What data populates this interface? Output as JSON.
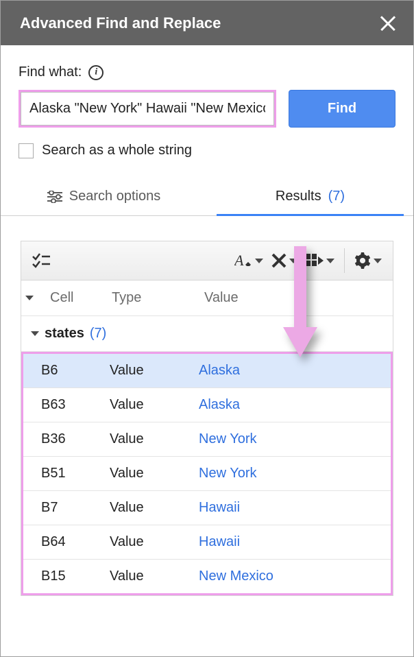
{
  "header": {
    "title": "Advanced Find and Replace"
  },
  "find": {
    "label": "Find what:",
    "value": "Alaska \"New York\" Hawaii \"New Mexico\"",
    "button": "Find",
    "whole_string_label": "Search as a whole string"
  },
  "tabs": {
    "search_options": "Search options",
    "results_label": "Results",
    "results_count": "(7)"
  },
  "table": {
    "headers": {
      "cell": "Cell",
      "type": "Type",
      "value": "Value"
    },
    "group": {
      "name": "states",
      "count": "(7)"
    },
    "rows": [
      {
        "cell": "B6",
        "type": "Value",
        "value": "Alaska",
        "selected": true
      },
      {
        "cell": "B63",
        "type": "Value",
        "value": "Alaska",
        "selected": false
      },
      {
        "cell": "B36",
        "type": "Value",
        "value": "New York",
        "selected": false
      },
      {
        "cell": "B51",
        "type": "Value",
        "value": "New York",
        "selected": false
      },
      {
        "cell": "B7",
        "type": "Value",
        "value": "Hawaii",
        "selected": false
      },
      {
        "cell": "B64",
        "type": "Value",
        "value": "Hawaii",
        "selected": false
      },
      {
        "cell": "B15",
        "type": "Value",
        "value": "New Mexico",
        "selected": false
      }
    ]
  },
  "colors": {
    "accent_blue": "#2f6fde",
    "highlight_pink": "#ee9eea",
    "arrow_pink": "#f0a8e8",
    "header_gray": "#636363"
  }
}
